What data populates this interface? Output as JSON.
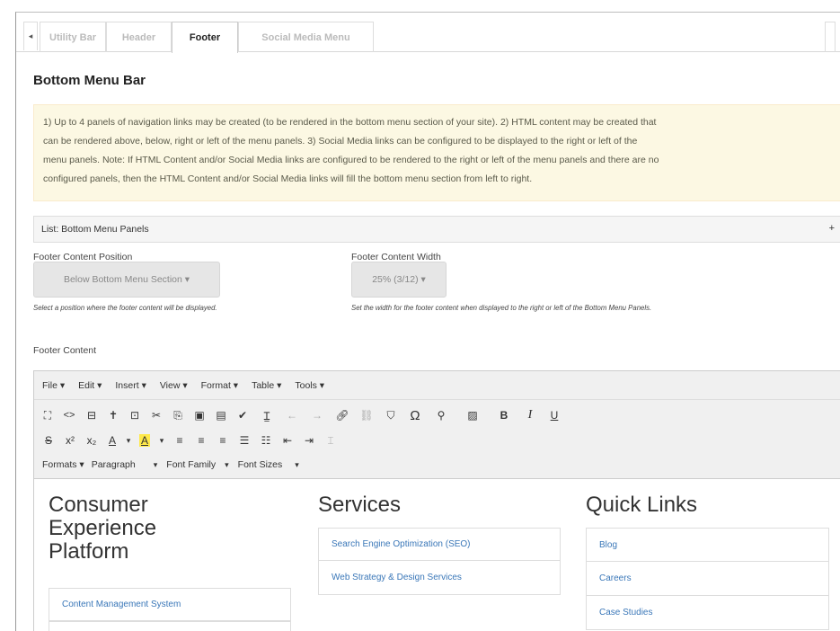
{
  "tabs": {
    "arrow": "◂",
    "items": [
      {
        "label": "Utility Bar",
        "active": false
      },
      {
        "label": "Header",
        "active": false
      },
      {
        "label": "Footer",
        "active": true
      },
      {
        "label": "Social Media Menu",
        "active": false
      }
    ]
  },
  "section_title": "Bottom Menu Bar",
  "notice": {
    "line1": "1) Up to 4 panels of navigation links may be created (to be rendered in the bottom menu section of your site). 2) HTML content may be created that",
    "line2": "can be rendered above, below, right or left of the menu panels. 3) Social Media links can be configured to be displayed to the right or left of the",
    "line3": "menu panels. Note: If HTML Content and/or Social Media links are configured to be rendered to the right or left of the menu panels and there are no",
    "line4": "configured panels, then the HTML Content and/or Social Media links will fill the bottom menu section from left to right."
  },
  "list_bar": {
    "label": "List: Bottom Menu Panels",
    "plus": "+"
  },
  "footer_position": {
    "label": "Footer Content Position",
    "value": "Below Bottom Menu Section ▾",
    "help": "Select a position where the footer content will be displayed."
  },
  "footer_width": {
    "label": "Footer Content Width",
    "value": "25% (3/12) ▾",
    "help": "Set the width for the footer content when displayed to the right or left of the Bottom Menu Panels."
  },
  "footer_content_label": "Footer Content",
  "editor": {
    "menus": [
      "File ▾",
      "Edit ▾",
      "Insert ▾",
      "View ▾",
      "Format ▾",
      "Table ▾",
      "Tools ▾"
    ],
    "row3": {
      "formats": "Formats ▾",
      "paragraph": "Paragraph",
      "paragraph_caret": "▾",
      "font_family": "Font Family",
      "font_family_caret": "▾",
      "font_sizes": "Font Sizes",
      "font_sizes_caret": "▾"
    }
  },
  "content": {
    "col1": {
      "title_line1": "Consumer",
      "title_line2": "Experience",
      "title_line3": "Platform",
      "links": [
        "Content Management System"
      ]
    },
    "col2": {
      "title": "Services",
      "links": [
        "Search Engine Optimization (SEO)",
        "Web Strategy & Design Services"
      ]
    },
    "col3": {
      "title": "Quick Links",
      "links": [
        "Blog",
        "Careers",
        "Case Studies"
      ]
    }
  }
}
